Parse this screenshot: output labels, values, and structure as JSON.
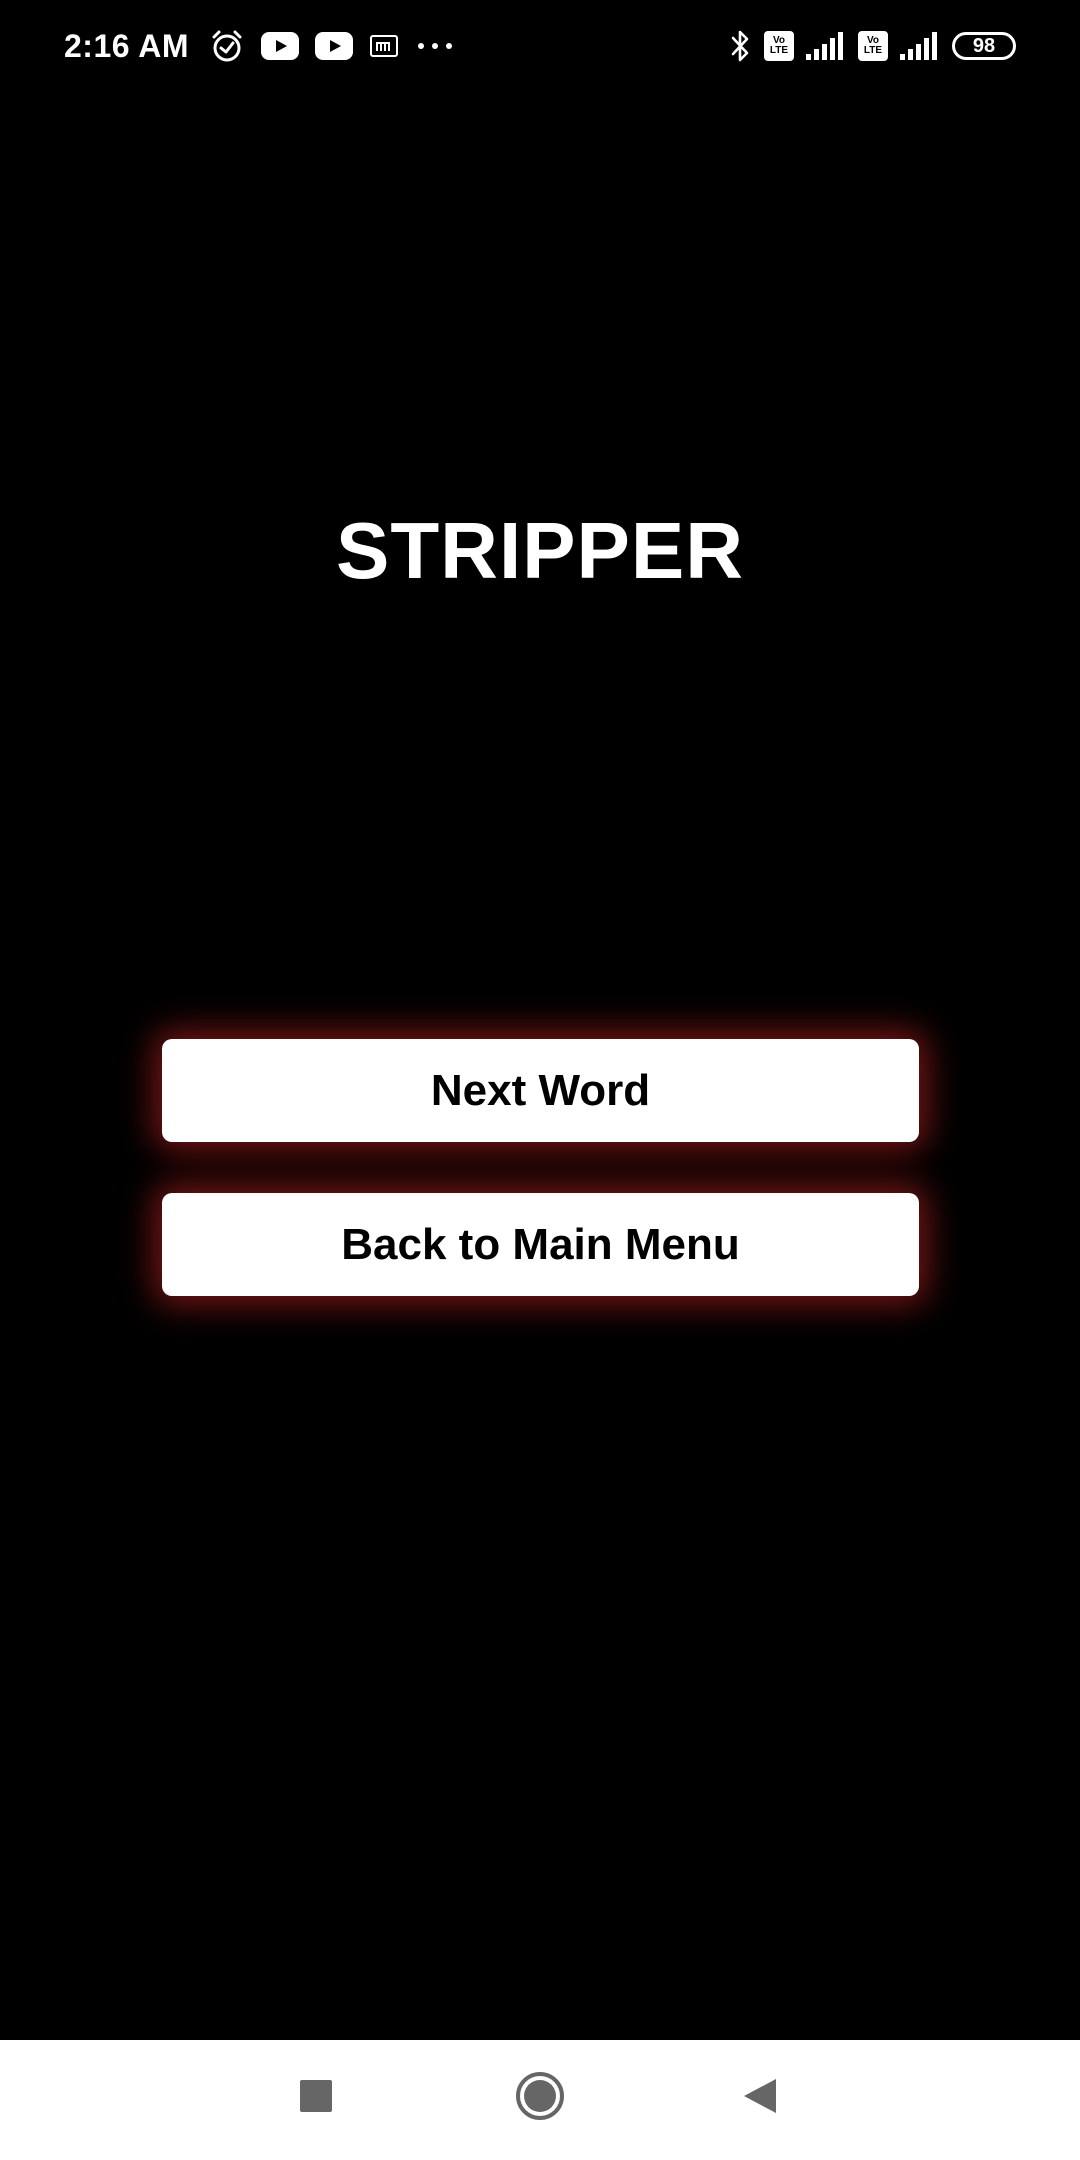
{
  "status_bar": {
    "time": "2:16 AM",
    "left_icons": [
      "alarm-icon",
      "youtube-icon",
      "youtube-icon",
      "app-notification-icon",
      "more-notifications-icon"
    ],
    "right_icons": [
      "bluetooth-icon",
      "volte-icon",
      "signal-icon",
      "volte-icon",
      "signal-icon",
      "battery-icon"
    ],
    "volte_top": "Vo",
    "volte_bottom": "LTE",
    "battery_level": "98"
  },
  "main": {
    "word": "STRIPPER",
    "next_button_label": "Next Word",
    "back_button_label": "Back to Main Menu"
  },
  "nav_bar": {
    "icons": [
      "recents-icon",
      "home-icon",
      "back-icon"
    ]
  },
  "colors": {
    "background": "#000000",
    "text": "#ffffff",
    "button_background": "#ffffff",
    "button_text": "#000000",
    "button_glow": "#dc2828",
    "nav_background": "#ffffff",
    "nav_icon": "#666666"
  }
}
